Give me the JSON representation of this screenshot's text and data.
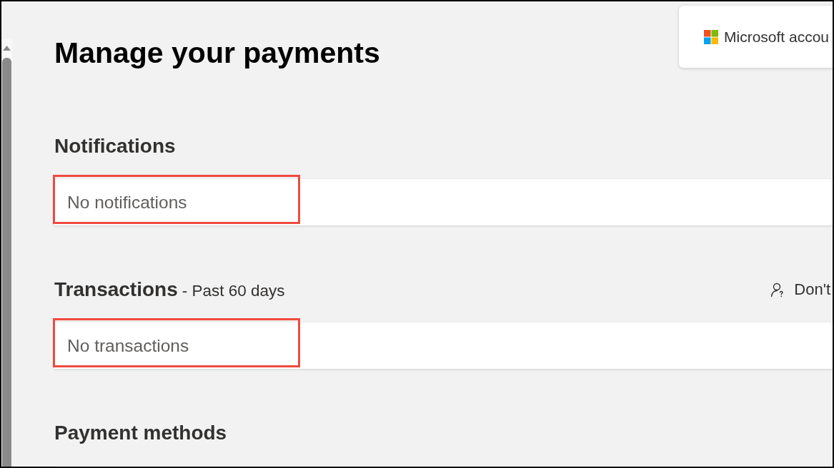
{
  "page": {
    "title": "Manage your payments"
  },
  "account_card": {
    "label": "Microsoft accou"
  },
  "sections": [
    {
      "title": "Notifications",
      "empty_text": "No notifications",
      "highlighted": true
    },
    {
      "title": "Transactions",
      "subtitle": "- Past 60 days",
      "action": {
        "label": "Don't"
      },
      "empty_text": "No transactions",
      "highlighted": true
    },
    {
      "title": "Payment methods",
      "highlighted": false
    }
  ]
}
